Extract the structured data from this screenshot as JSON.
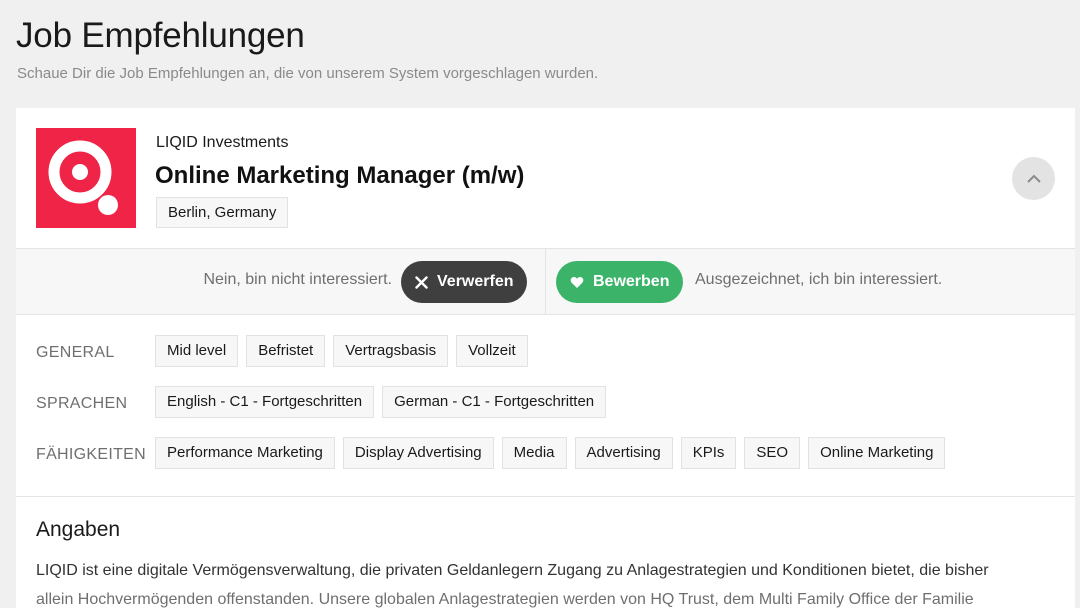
{
  "page": {
    "title": "Job Empfehlungen",
    "subtitle": "Schaue Dir die Job Empfehlungen an, die von unserem System vorgeschlagen wurden."
  },
  "job": {
    "company": "LIQID Investments",
    "title": "Online Marketing Manager (m/w)",
    "location": "Berlin, Germany",
    "logo_color": "#ef2447"
  },
  "actions": {
    "reject_hint": "Nein, bin nicht interessiert.",
    "reject_label": "Verwerfen",
    "accept_label": "Bewerben",
    "accept_hint": "Ausgezeichnet, ich bin interessiert.",
    "reject_color": "#3f3f3f",
    "accept_color": "#3bb46a"
  },
  "tags": {
    "general": {
      "label": "GENERAL",
      "items": [
        "Mid level",
        "Befristet",
        "Vertragsbasis",
        "Vollzeit"
      ]
    },
    "languages": {
      "label": "SPRACHEN",
      "items": [
        "English - C1 - Fortgeschritten",
        "German - C1 - Fortgeschritten"
      ]
    },
    "skills": {
      "label": "FÄHIGKEITEN",
      "items": [
        "Performance Marketing",
        "Display Advertising",
        "Media",
        "Advertising",
        "KPIs",
        "SEO",
        "Online Marketing"
      ]
    }
  },
  "details": {
    "title": "Angaben",
    "line1": "LIQID ist eine digitale Vermögensverwaltung, die privaten Geldanlegern Zugang zu Anlagestrategien und Konditionen bietet, die bisher",
    "line2": "allein Hochvermögenden offenstanden. Unsere globalen Anlagestrategien werden von HQ Trust, dem Multi Family Office der Familie"
  },
  "icons": {
    "collapse": "chevron-up-icon",
    "reject": "close-icon",
    "accept": "heart-icon",
    "logo": "liqid-logo-icon"
  }
}
